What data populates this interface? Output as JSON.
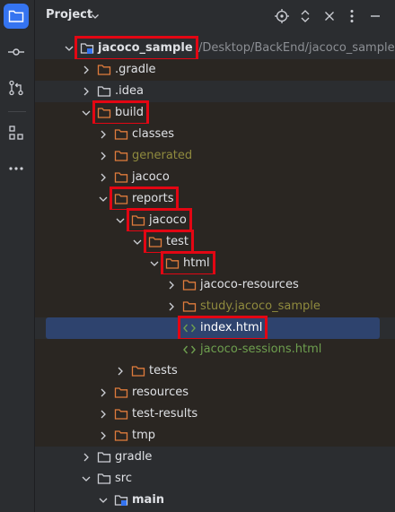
{
  "toolbar": {
    "tools": [
      {
        "name": "project-tool-button",
        "icon": "folder-icon",
        "active": true
      },
      {
        "name": "commit-tool-button",
        "icon": "commit-icon",
        "active": false
      },
      {
        "name": "pull-requests-tool-button",
        "icon": "pull-request-icon",
        "active": false
      },
      {
        "name": "structure-tool-button",
        "icon": "structure-icon",
        "active": false
      },
      {
        "name": "more-tools-button",
        "icon": "more-icon",
        "active": false
      }
    ]
  },
  "header": {
    "title": "Project",
    "icons": [
      "locate-icon",
      "expand-collapse-icon",
      "close-icon",
      "options-icon",
      "hide-icon"
    ]
  },
  "tree": {
    "rows": [
      {
        "label": "jacoco_sample",
        "path": "/Desktop/BackEnd/jacoco_sample",
        "chevron": "down",
        "icon": "module",
        "style": "bold",
        "depth": 0,
        "highlight": true
      },
      {
        "label": ".gradle",
        "chevron": "right",
        "icon": "folder-orange",
        "style": "normal",
        "depth": 1,
        "dark": true
      },
      {
        "label": ".idea",
        "chevron": "right",
        "icon": "folder",
        "style": "normal",
        "depth": 1
      },
      {
        "label": "build",
        "chevron": "down",
        "icon": "folder-orange",
        "style": "normal",
        "depth": 1,
        "dark": true,
        "highlight": true
      },
      {
        "label": "classes",
        "chevron": "right",
        "icon": "folder-orange",
        "style": "normal",
        "depth": 2,
        "dark": true
      },
      {
        "label": "generated",
        "chevron": "right",
        "icon": "folder-orange",
        "style": "generated",
        "depth": 2,
        "dark": true
      },
      {
        "label": "jacoco",
        "chevron": "right",
        "icon": "folder-orange",
        "style": "normal",
        "depth": 2,
        "dark": true
      },
      {
        "label": "reports",
        "chevron": "down",
        "icon": "folder-orange",
        "style": "normal",
        "depth": 2,
        "dark": true,
        "highlight": true
      },
      {
        "label": "jacoco",
        "chevron": "down",
        "icon": "folder-orange",
        "style": "normal",
        "depth": 3,
        "dark": true,
        "highlight": true
      },
      {
        "label": "test",
        "chevron": "down",
        "icon": "folder-orange",
        "style": "normal",
        "depth": 4,
        "dark": true,
        "highlight": true
      },
      {
        "label": "html",
        "chevron": "down",
        "icon": "folder-orange",
        "style": "normal",
        "depth": 5,
        "dark": true,
        "highlight": true
      },
      {
        "label": "jacoco-resources",
        "chevron": "right",
        "icon": "folder-orange",
        "style": "normal",
        "depth": 6,
        "dark": true
      },
      {
        "label": "study.jacoco_sample",
        "chevron": "right",
        "icon": "folder-orange",
        "style": "generated",
        "depth": 6,
        "dark": true
      },
      {
        "label": "index.html",
        "chevron": "none",
        "icon": "html-file",
        "style": "selected",
        "depth": 6,
        "selected": true,
        "highlight": true
      },
      {
        "label": "jacoco-sessions.html",
        "chevron": "none",
        "icon": "html-file",
        "style": "html-file",
        "depth": 6,
        "dark": true
      },
      {
        "label": "tests",
        "chevron": "right",
        "icon": "folder-orange",
        "style": "normal",
        "depth": 3,
        "dark": true
      },
      {
        "label": "resources",
        "chevron": "right",
        "icon": "folder-orange",
        "style": "normal",
        "depth": 2,
        "dark": true
      },
      {
        "label": "test-results",
        "chevron": "right",
        "icon": "folder-orange",
        "style": "normal",
        "depth": 2,
        "dark": true
      },
      {
        "label": "tmp",
        "chevron": "right",
        "icon": "folder-orange",
        "style": "normal",
        "depth": 2,
        "dark": true
      },
      {
        "label": "gradle",
        "chevron": "right",
        "icon": "folder",
        "style": "normal",
        "depth": 1
      },
      {
        "label": "src",
        "chevron": "down",
        "icon": "folder",
        "style": "normal",
        "depth": 1
      },
      {
        "label": "main",
        "chevron": "down",
        "icon": "folder-module",
        "style": "bold",
        "depth": 2
      }
    ]
  },
  "colors": {
    "accent": "#3574f0",
    "highlight_box": "#e30613",
    "selection": "#2e436e",
    "excluded_text": "#8f8a3e",
    "html_file_text": "#6e9f4f"
  }
}
